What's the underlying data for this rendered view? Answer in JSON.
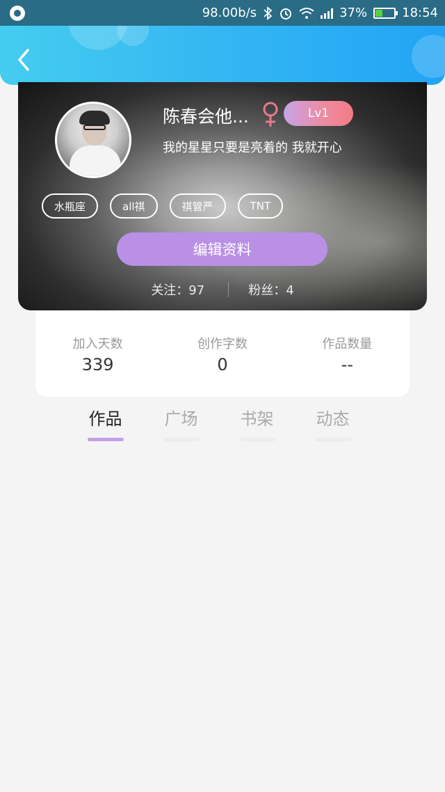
{
  "status_bar": {
    "speed": "98.00b/s",
    "battery_percent": "37%",
    "battery_level": 0.37,
    "time": "18:54",
    "icons": [
      "app-icon",
      "bluetooth-icon",
      "alarm-icon",
      "wifi-icon",
      "signal-icon",
      "battery-icon"
    ]
  },
  "header": {
    "back_icon": "chevron-left-icon",
    "accent_color": "#35b8f2"
  },
  "profile": {
    "name": "陈春会他...",
    "gender_icon": "female-icon",
    "level": "Lv1",
    "signature": "我的星星只要是亮着的 我就开心",
    "tags": [
      "水瓶座",
      "all祺",
      "祺管严",
      "TNT"
    ],
    "edit_button": "编辑资料",
    "follow_label": "关注：97",
    "fans_label": "粉丝：4"
  },
  "stats": [
    {
      "label": "加入天数",
      "value": "339"
    },
    {
      "label": "创作字数",
      "value": "0"
    },
    {
      "label": "作品数量",
      "value": "--"
    }
  ],
  "tabs": [
    {
      "label": "作品",
      "active": true
    },
    {
      "label": "广场",
      "active": false
    },
    {
      "label": "书架",
      "active": false
    },
    {
      "label": "动态",
      "active": false
    }
  ],
  "colors": {
    "edit_button": "#b990e6",
    "active_tab_indicator": "#c3a0e6",
    "gender": "#e87a8a"
  }
}
